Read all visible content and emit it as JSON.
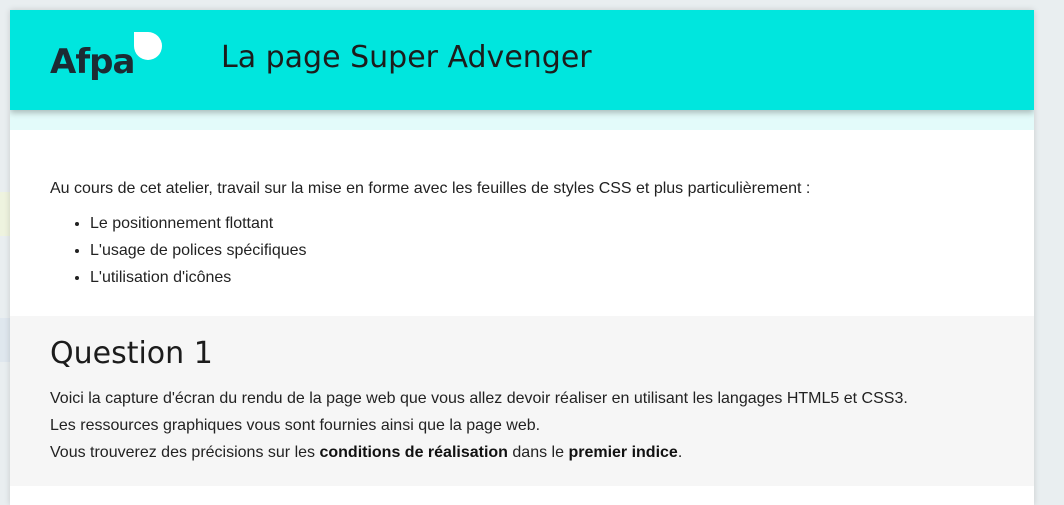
{
  "header": {
    "logo_text": "Afpa",
    "title": "La page Super Advenger"
  },
  "intro": {
    "text": "Au cours de cet atelier, travail sur la mise en forme avec les feuilles de styles CSS et plus particulièrement :",
    "items": [
      "Le positionnement flottant",
      "L'usage de polices spécifiques",
      "L'utilisation d'icônes"
    ]
  },
  "question": {
    "title": "Question 1",
    "line1": "Voici la capture d'écran du rendu de la page web que vous allez devoir réaliser en utilisant les langages HTML5 et CSS3.",
    "line2": "Les ressources graphiques vous sont fournies ainsi que la page web.",
    "line3_a": "Vous trouverez des précisions sur les ",
    "line3_b": "conditions de réalisation",
    "line3_c": " dans le ",
    "line3_d": "premier indice",
    "line3_e": "."
  },
  "colors": {
    "header_bg": "#00e6de",
    "header_band": "#e3fbfa",
    "question_bg": "#f6f6f6"
  }
}
